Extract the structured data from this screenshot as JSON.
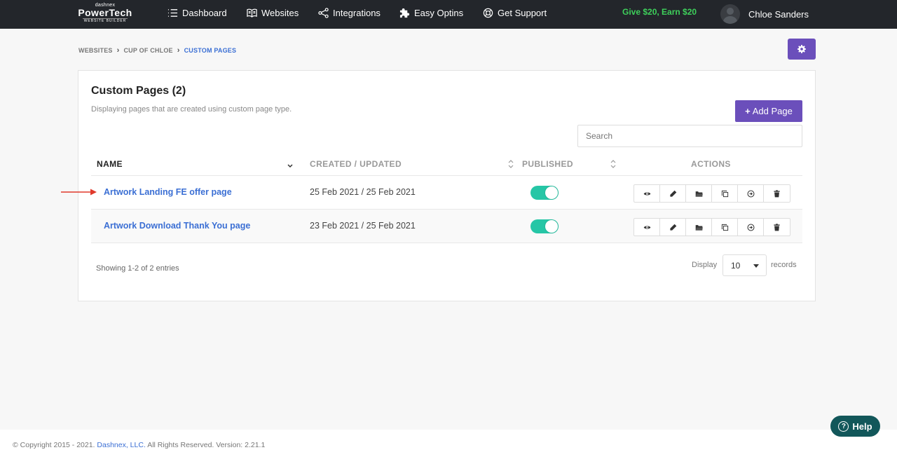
{
  "logo": {
    "small": "dashnex",
    "big": "PowerTech",
    "sub": "WEBSITE BUILDER"
  },
  "nav": {
    "items": [
      {
        "label": "Dashboard",
        "icon": "list-icon"
      },
      {
        "label": "Websites",
        "icon": "book-icon"
      },
      {
        "label": "Integrations",
        "icon": "share-icon"
      },
      {
        "label": "Easy Optins",
        "icon": "puzzle-icon"
      },
      {
        "label": "Get Support",
        "icon": "lifebuoy-icon"
      }
    ],
    "promo": "Give $20, Earn $20",
    "user_name": "Chloe Sanders",
    "promo_color": "#3ed05b"
  },
  "breadcrumb": {
    "items": [
      "WEBSITES",
      "CUP OF CHLOE",
      "CUSTOM PAGES"
    ]
  },
  "card": {
    "title": "Custom Pages (2)",
    "subtitle": "Displaying pages that are created using custom page type.",
    "add_button": "Add Page",
    "search_placeholder": "Search"
  },
  "table": {
    "headers": {
      "name": "NAME",
      "created": "CREATED / UPDATED",
      "published": "PUBLISHED",
      "actions": "ACTIONS"
    },
    "rows": [
      {
        "name": "Artwork Landing FE offer page",
        "dates": "25 Feb 2021 / 25 Feb 2021",
        "published": true
      },
      {
        "name": "Artwork Download Thank You page",
        "dates": "23 Feb 2021 / 25 Feb 2021",
        "published": true
      }
    ],
    "action_icons": [
      "eye-icon",
      "pencil-icon",
      "folder-icon",
      "copy-icon",
      "arrow-circle-icon",
      "trash-icon"
    ]
  },
  "pagination": {
    "showing": "Showing 1-2 of 2 entries",
    "display_label": "Display",
    "display_value": "10",
    "records_label": "records"
  },
  "footer": {
    "prefix": "© Copyright 2015 - 2021.",
    "company": "Dashnex, LLC.",
    "suffix": "All Rights Reserved. Version: 2.21.1"
  },
  "help": {
    "label": "Help"
  },
  "colors": {
    "accent": "#6b4fbb",
    "link": "#3b6fd4",
    "toggle": "#26c6a6",
    "help": "#12575a"
  }
}
